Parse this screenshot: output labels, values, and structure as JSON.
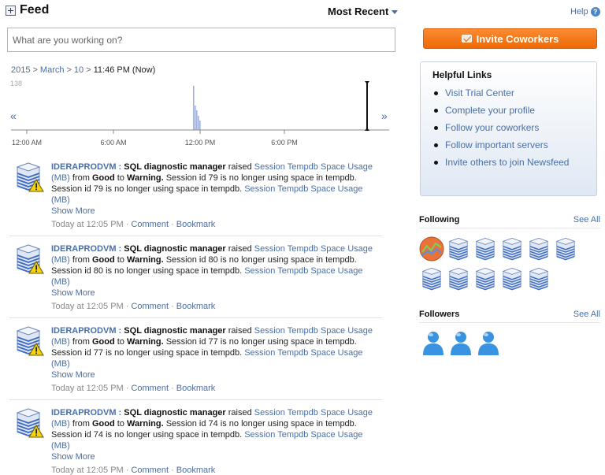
{
  "header": {
    "title": "Feed",
    "sort_label": "Most Recent",
    "help_label": "Help"
  },
  "status": {
    "placeholder": "What are you working on?"
  },
  "breadcrumb": {
    "year": "2015",
    "month": "March",
    "day": "10",
    "time": "11:46 PM (Now)"
  },
  "timeline": {
    "ymax_label": "138",
    "prev_label": "«",
    "next_label": "»",
    "tick_labels": [
      "12:00 AM",
      "6:00 AM",
      "12:00 PM",
      "6:00 PM"
    ],
    "activity_levels": [
      1.0,
      0.55,
      0.45,
      0.32,
      0.22
    ],
    "colors": {
      "bar": "#9bb5e8",
      "axis": "#888888"
    }
  },
  "feed": {
    "items": [
      {
        "server": "IDERAPRODVM :",
        "app": "SQL diagnostic manager",
        "raised": "raised",
        "metric": "Session Tempdb Space Usage (MB)",
        "from_word": "from",
        "from_state": "Good",
        "to_word": "to",
        "to_state": "Warning.",
        "message": "Session id 79 is no longer using space in tempdb. Session id 79 is no longer using space in tempdb.",
        "metric_repeat": "Session Tempdb Space Usage (MB)",
        "show_more": "Show More",
        "time": "Today at 12:05 PM",
        "comment": "Comment",
        "bookmark": "Bookmark"
      },
      {
        "server": "IDERAPRODVM :",
        "app": "SQL diagnostic manager",
        "raised": "raised",
        "metric": "Session Tempdb Space Usage (MB)",
        "from_word": "from",
        "from_state": "Good",
        "to_word": "to",
        "to_state": "Warning.",
        "message": "Session id 80 is no longer using space in tempdb. Session id 80 is no longer using space in tempdb.",
        "metric_repeat": "Session Tempdb Space Usage (MB)",
        "show_more": "Show More",
        "time": "Today at 12:05 PM",
        "comment": "Comment",
        "bookmark": "Bookmark"
      },
      {
        "server": "IDERAPRODVM :",
        "app": "SQL diagnostic manager",
        "raised": "raised",
        "metric": "Session Tempdb Space Usage (MB)",
        "from_word": "from",
        "from_state": "Good",
        "to_word": "to",
        "to_state": "Warning.",
        "message": "Session id 77 is no longer using space in tempdb. Session id 77 is no longer using space in tempdb.",
        "metric_repeat": "Session Tempdb Space Usage (MB)",
        "show_more": "Show More",
        "time": "Today at 12:05 PM",
        "comment": "Comment",
        "bookmark": "Bookmark"
      },
      {
        "server": "IDERAPRODVM :",
        "app": "SQL diagnostic manager",
        "raised": "raised",
        "metric": "Session Tempdb Space Usage (MB)",
        "from_word": "from",
        "from_state": "Good",
        "to_word": "to",
        "to_state": "Warning.",
        "message": "Session id 74 is no longer using space in tempdb. Session id 74 is no longer using space in tempdb.",
        "metric_repeat": "Session Tempdb Space Usage (MB)",
        "show_more": "Show More",
        "time": "Today at 12:05 PM",
        "comment": "Comment",
        "bookmark": "Bookmark"
      }
    ]
  },
  "invite": {
    "label": "Invite Coworkers",
    "icon": "envelope-icon"
  },
  "helpful_links": {
    "title": "Helpful Links",
    "items": [
      "Visit Trial Center",
      "Complete your profile",
      "Follow your coworkers",
      "Follow important servers",
      "Invite others to join Newsfeed"
    ]
  },
  "following": {
    "title": "Following",
    "see_all": "See All",
    "items": [
      "chart-icon",
      "server-icon",
      "server-icon",
      "server-icon",
      "server-icon",
      "server-icon",
      "server-icon",
      "server-icon",
      "server-icon",
      "server-icon",
      "server-icon"
    ]
  },
  "followers": {
    "title": "Followers",
    "see_all": "See All",
    "count_icons": [
      "user-icon",
      "user-icon",
      "user-icon"
    ]
  },
  "colors": {
    "link": "#4a6fa5",
    "accent_orange": "#f07a18",
    "server_blue": "#3f6cc2",
    "warning_yellow": "#f5d40f",
    "user_blue": "#3a93e0"
  }
}
